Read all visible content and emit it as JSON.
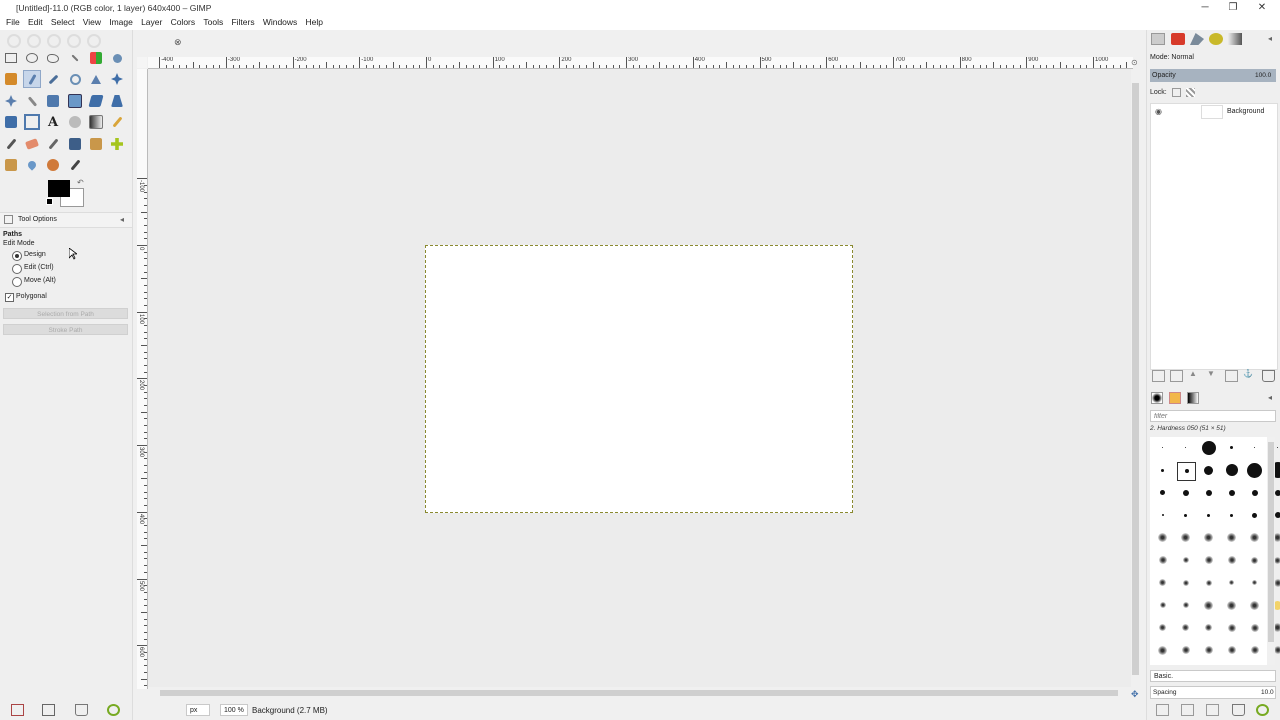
{
  "window": {
    "title": "[Untitled]-11.0 (RGB color, 1 layer) 640x400 – GIMP",
    "minimize": "─",
    "maximize": "❐",
    "close": "✕"
  },
  "menubar": {
    "items": [
      {
        "label": "File"
      },
      {
        "label": "Edit"
      },
      {
        "label": "Select"
      },
      {
        "label": "View"
      },
      {
        "label": "Image"
      },
      {
        "label": "Layer"
      },
      {
        "label": "Colors"
      },
      {
        "label": "Tools"
      },
      {
        "label": "Filters"
      },
      {
        "label": "Windows"
      },
      {
        "label": "Help"
      }
    ]
  },
  "tool_options": {
    "tab_label": "Tool Options",
    "section": "Paths",
    "edit_mode_label": "Edit Mode",
    "modes": [
      "Design",
      "Edit (Ctrl)",
      "Move (Alt)"
    ],
    "selected_mode": "Design",
    "polygonal_label": "Polygonal",
    "polygonal_checked": true,
    "selection_from_path": "Selection from Path",
    "stroke_path": "Stroke Path"
  },
  "ruler": {
    "h_labels": [
      "-400",
      "-300",
      "-200",
      "-100",
      "0",
      "100",
      "200",
      "300",
      "400",
      "500",
      "600",
      "700",
      "800",
      "900",
      "1000"
    ],
    "v_labels": [
      "-100",
      "0",
      "100",
      "200",
      "300",
      "400",
      "500",
      "600"
    ]
  },
  "statusbar": {
    "unit": "px",
    "zoom": "100 %",
    "message": "Background (2.7 MB)"
  },
  "layers": {
    "mode_label": "Mode: Normal",
    "opacity_label": "Opacity",
    "opacity_value": "100.0",
    "lock_label": "Lock:",
    "layer_name": "Background"
  },
  "brushes": {
    "filter_placeholder": "filter",
    "current_brush": "2. Hardness 050 (51 × 51)",
    "preset": "Basic.",
    "spacing_label": "Spacing",
    "spacing_value": "10.0"
  },
  "colors": {
    "foreground": "#000000",
    "background": "#ffffff",
    "selection_border": "#8a8a30",
    "active_tool": "#c7d6ea"
  }
}
